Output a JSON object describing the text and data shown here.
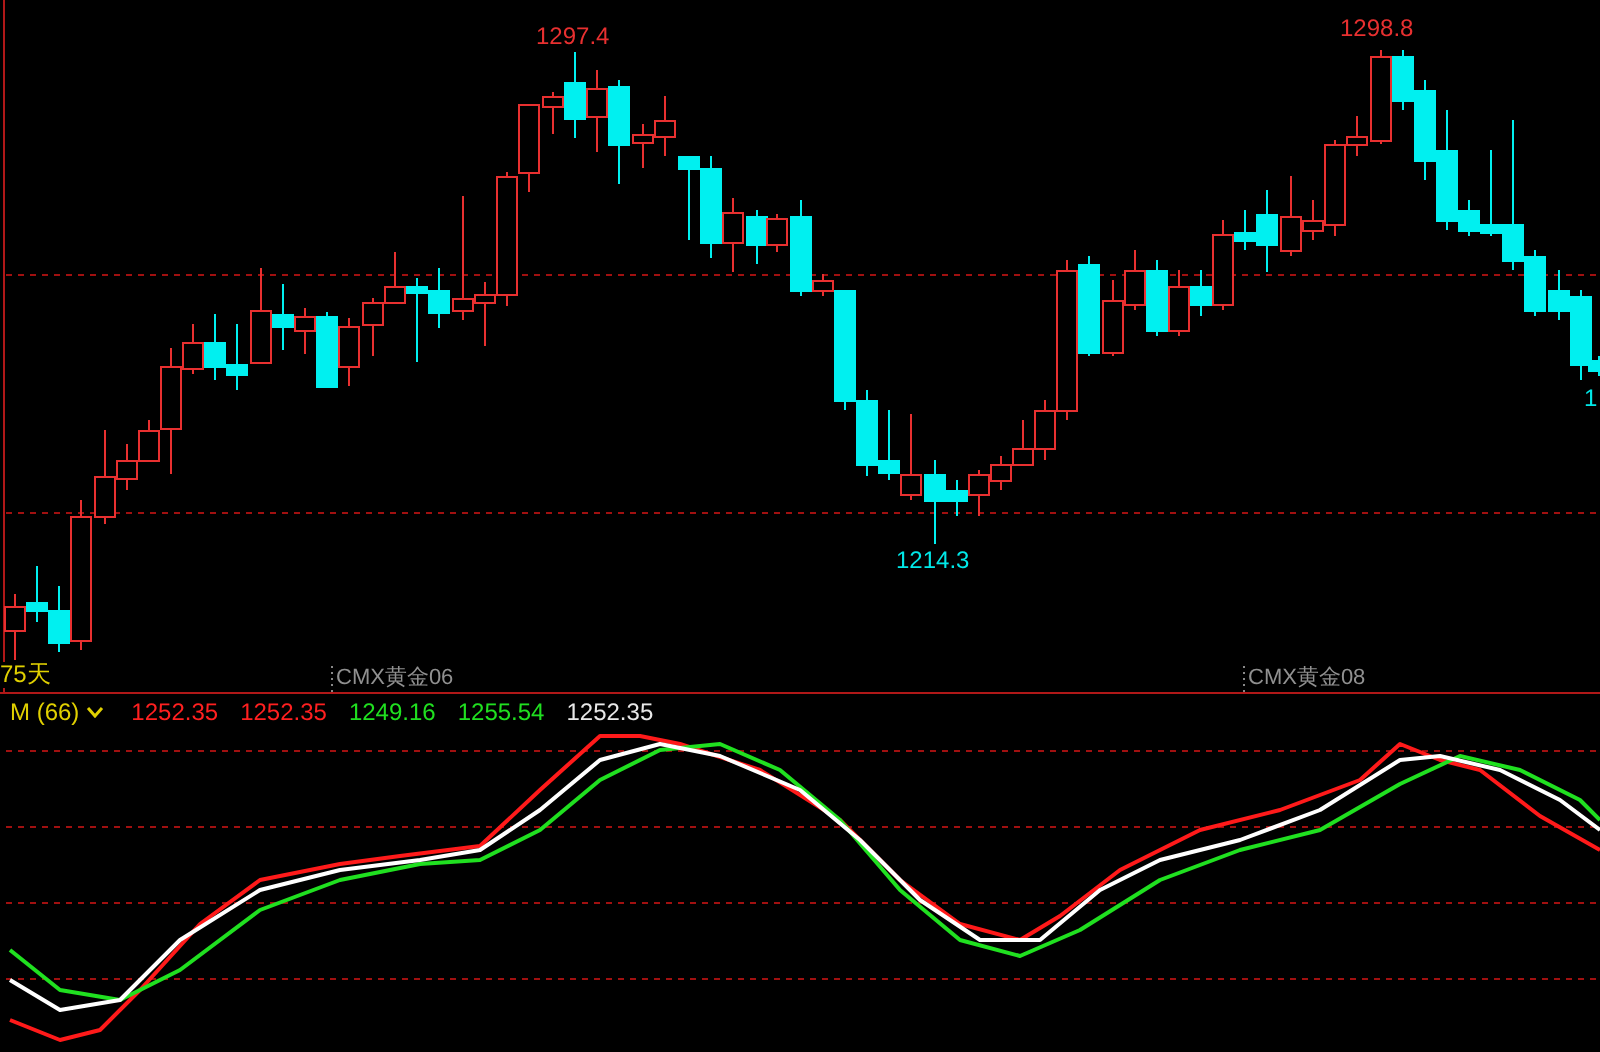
{
  "main_chart": {
    "markers": [
      {
        "text": "1297.4",
        "kind": "high"
      },
      {
        "text": "1298.8",
        "kind": "high"
      },
      {
        "text": "1214.3",
        "kind": "low"
      },
      {
        "text": "1",
        "kind": "low"
      }
    ],
    "period_label": "75天",
    "contract_labels": [
      "CMX黄金06",
      "CMX黄金08"
    ]
  },
  "indicator": {
    "name": "M (66)",
    "values": [
      {
        "text": "1252.35",
        "color": "#ff2020"
      },
      {
        "text": "1252.35",
        "color": "#ff2020"
      },
      {
        "text": "1249.16",
        "color": "#20e020"
      },
      {
        "text": "1255.54",
        "color": "#20e020"
      },
      {
        "text": "1252.35",
        "color": "#e8e8e8"
      }
    ]
  }
}
